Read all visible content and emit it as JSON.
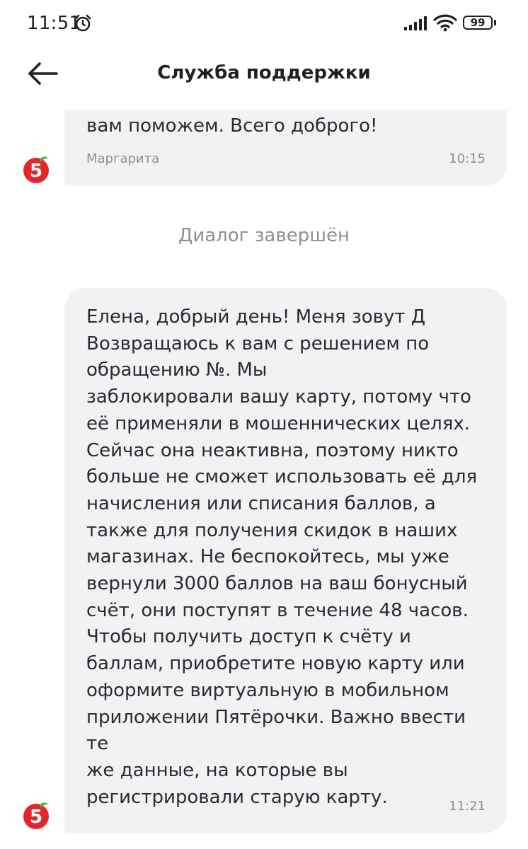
{
  "status_bar": {
    "time": "11:51",
    "battery": "99",
    "icons": [
      "alarm-icon",
      "signal-icon",
      "wifi-icon",
      "battery-icon"
    ]
  },
  "header": {
    "title": "Служба поддержки",
    "back_icon": "arrow-left-icon"
  },
  "messages": [
    {
      "text": "вам поможем. Всего доброго!",
      "sender": "Маргарита",
      "time": "10:15",
      "avatar": "pyaterochka-logo"
    },
    {
      "text": "Елена, добрый день! Меня зовут Д\nВозвращаюсь к вам с решением по\nобращению №. Мы\nзаблокировали вашу карту, потому что\nеё применяли в мошеннических целях.\nСейчас она неактивна, поэтому никто\nбольше не сможет использовать её для\nначисления или списания баллов, а\nтакже для получения скидок в наших\nмагазинах. Не беспокойтесь, мы уже\nвернули 3000 баллов на ваш бонусный\nсчёт, они поступят в течение 48 часов.\nЧтобы получить доступ к счёту и\nбаллам, приобретите новую карту или\nоформите виртуальную в мобильном\nприложении Пятёрочки. Важно ввести те\nже данные, на которые вы\nрегистрировали старую карту.",
      "time": "11:21",
      "avatar": "pyaterochka-logo"
    }
  ],
  "system_note": "Диалог завершён",
  "colors": {
    "bubble": "#f2f2f4",
    "muted_text": "#8e8e94",
    "brand_red": "#e3262b",
    "brand_green": "#52b232"
  }
}
